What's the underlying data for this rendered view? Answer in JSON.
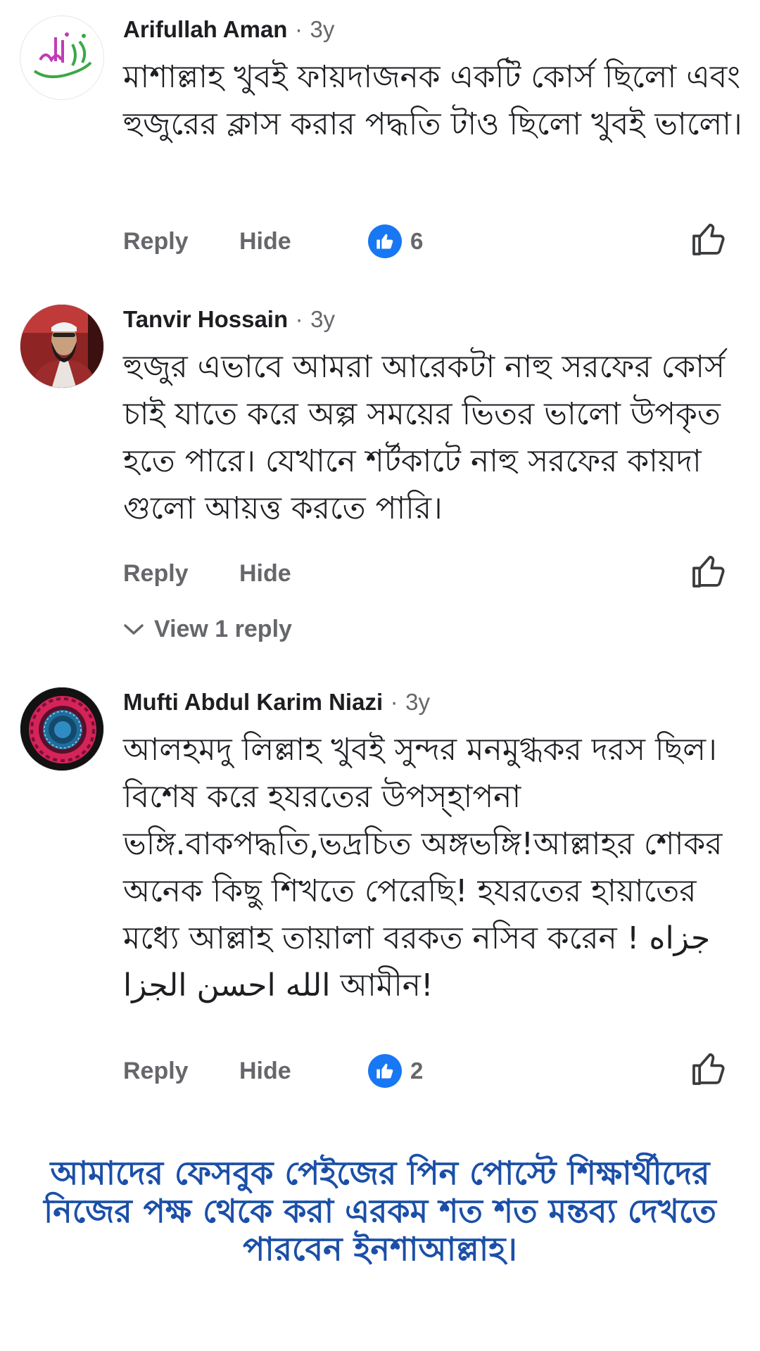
{
  "comments": [
    {
      "author": "Arifullah Aman",
      "separator": "·",
      "time": "3y",
      "text": "মাশাল্লাহ খুবই ফায়দাজনক একটি কোর্স ছিলো এবং হুজুরের ক্লাস করার পদ্ধতি টাও ছিলো খুবই ভালো।",
      "reply_label": "Reply",
      "hide_label": "Hide",
      "reaction_count": "6"
    },
    {
      "author": "Tanvir Hossain",
      "separator": "·",
      "time": "3y",
      "text": "হুজুর এভাবে আমরা আরেকটা নাহু সরফের কোর্স চাই যাতে করে অল্প সময়ের ভিতর ভালো উপকৃত হতে পারে। যেখানে শর্টকাটে নাহু সরফের কায়দা গুলো আয়ত্ত করতে পারি।",
      "reply_label": "Reply",
      "hide_label": "Hide",
      "view_replies_label": "View 1 reply"
    },
    {
      "author": "Mufti Abdul Karim Niazi",
      "separator": "·",
      "time": "3y",
      "text": "আলহমদু লিল্লাহ খুবই সুন্দর মনমুগ্ধকর দরস ছিল।বিশেষ করে হযরতের উপস্হাপনা ভঙ্গি.বাকপদ্ধতি,ভদ্রচিত অঙ্গভঙ্গি!আল্লাহর শোকর অনেক কিছু শিখতে পেরেছি! হযরতের হায়াতের মধ্যে আল্লাহ তায়ালা বরকত নসিব করেন ! جزاه الله احسن الجزا আমীন!",
      "reply_label": "Reply",
      "hide_label": "Hide",
      "reaction_count": "2"
    }
  ],
  "promo_text": "আমাদের ফেসবুক পেইজের পিন পোস্টে শিক্ষার্থীদের নিজের পক্ষ থেকে করা এরকম শত শত মন্তব্য দেখতে পারবেন ইনশাআল্লাহ।",
  "colors": {
    "reaction_blue": "#1877f2",
    "meta_gray": "#65676b",
    "promo_blue": "#1b4fa8"
  },
  "icons": [
    "like-reaction-icon",
    "like-outline-icon",
    "chevron-down-icon"
  ]
}
